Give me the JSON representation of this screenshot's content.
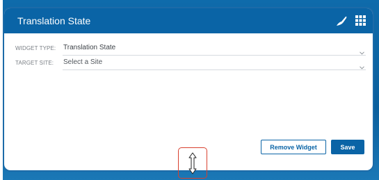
{
  "widget": {
    "title": "Translation State",
    "icons": {
      "customize": "brush-icon",
      "apps": "grid-icon"
    }
  },
  "form": {
    "widget_type": {
      "label": "WIDGET TYPE:",
      "value": "Translation State"
    },
    "target_site": {
      "label": "TARGET SITE:",
      "placeholder": "Select a Site"
    }
  },
  "actions": {
    "remove_label": "Remove Widget",
    "save_label": "Save"
  },
  "resize": {
    "icon": "vertical-resize-cursor-icon"
  },
  "colors": {
    "brand_blue": "#0a64a6",
    "highlight_red": "#d8402e"
  }
}
